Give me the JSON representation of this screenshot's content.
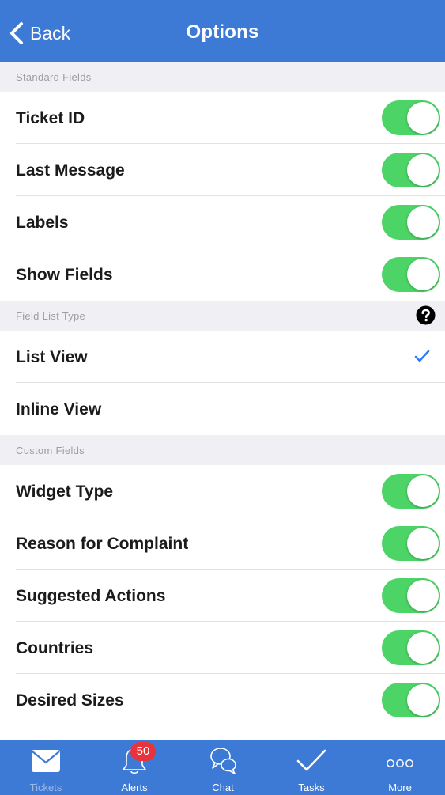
{
  "navbar": {
    "back_label": "Back",
    "title": "Options"
  },
  "sections": {
    "standard": {
      "header": "Standard Fields",
      "rows": [
        {
          "label": "Ticket ID",
          "on": true
        },
        {
          "label": "Last Message",
          "on": true
        },
        {
          "label": "Labels",
          "on": true
        },
        {
          "label": "Show Fields",
          "on": true
        }
      ]
    },
    "field_list_type": {
      "header": "Field List Type",
      "help_icon": "question-circle-icon",
      "rows": [
        {
          "label": "List View",
          "selected": true
        },
        {
          "label": "Inline View",
          "selected": false
        }
      ]
    },
    "custom": {
      "header": "Custom Fields",
      "rows": [
        {
          "label": "Widget Type",
          "on": true
        },
        {
          "label": "Reason for Complaint",
          "on": true
        },
        {
          "label": "Suggested Actions",
          "on": true
        },
        {
          "label": "Countries",
          "on": true
        },
        {
          "label": "Desired Sizes",
          "on": true
        }
      ]
    }
  },
  "tabbar": {
    "active": "Tickets",
    "tabs": [
      {
        "label": "Tickets",
        "icon": "envelope-icon"
      },
      {
        "label": "Alerts",
        "icon": "bell-icon",
        "badge": "50"
      },
      {
        "label": "Chat",
        "icon": "chat-bubbles-icon"
      },
      {
        "label": "Tasks",
        "icon": "checkmark-icon"
      },
      {
        "label": "More",
        "icon": "ellipsis-icon"
      }
    ]
  },
  "colors": {
    "nav_blue": "#3d7ad6",
    "toggle_on": "#4cd467",
    "badge_red": "#e8333d",
    "check_blue": "#2f7cf6",
    "section_bg": "#efeff4"
  }
}
